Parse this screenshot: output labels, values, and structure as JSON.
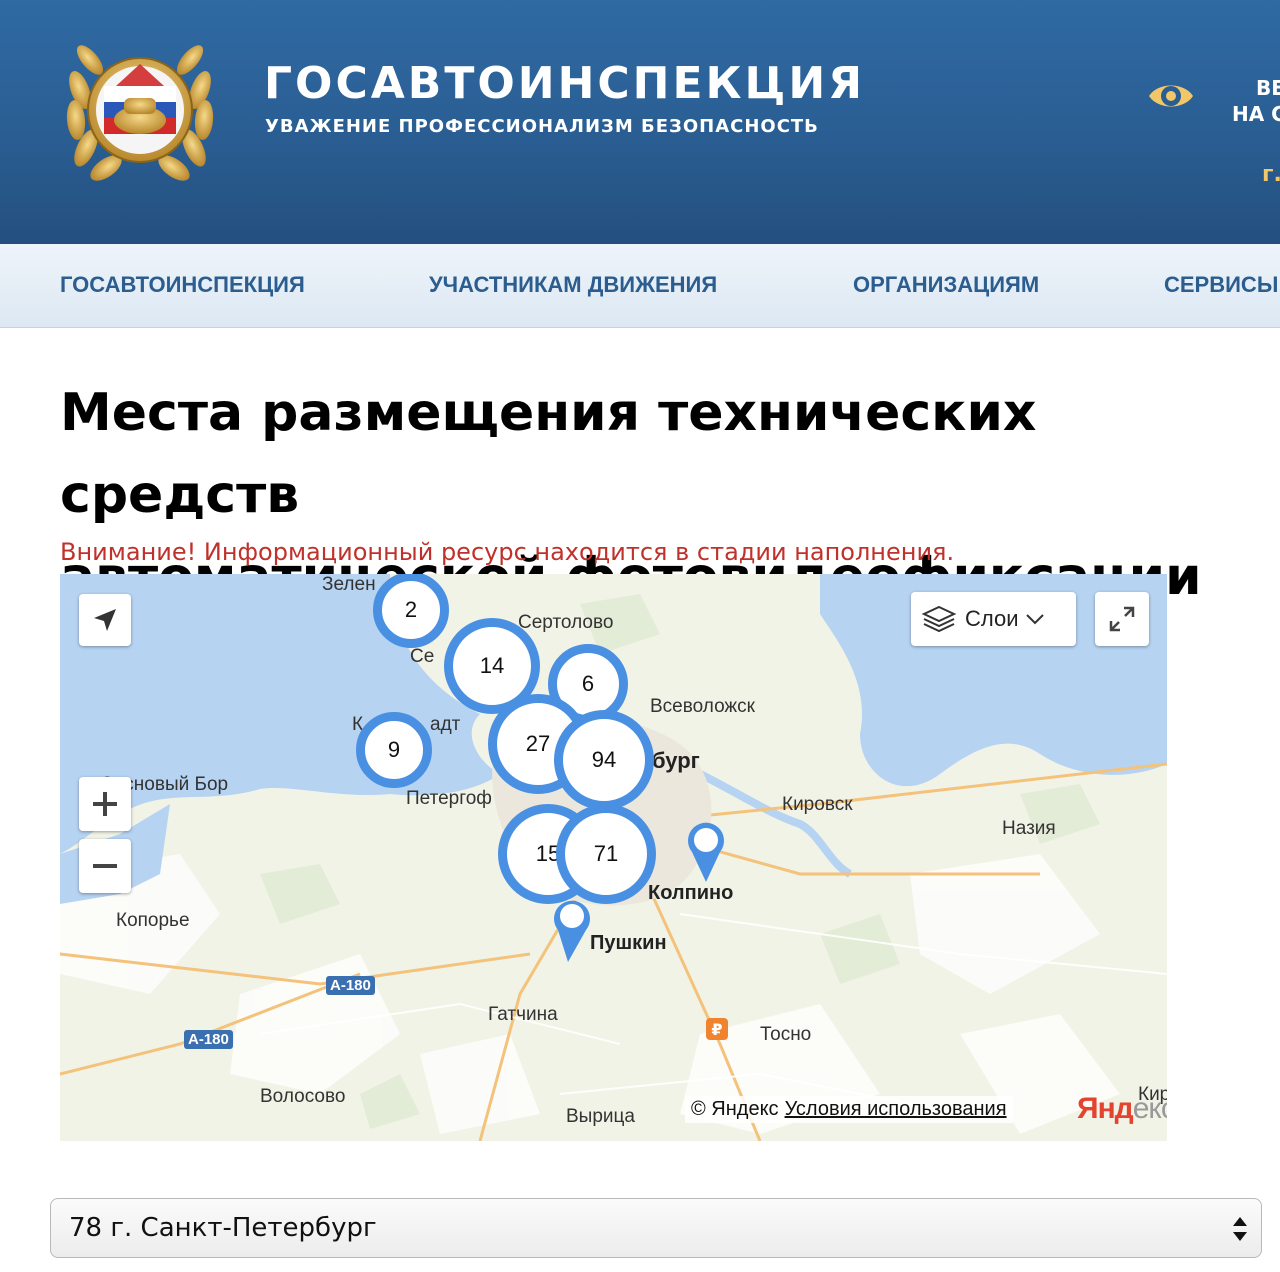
{
  "header": {
    "brand_title": "ГОСАВТОИНСПЕКЦИЯ",
    "brand_subtitle": "УВАЖЕНИЕ ПРОФЕССИОНАЛИЗМ БЕЗОПАСНОСТЬ",
    "visually_impaired_line1": "ВЕ",
    "visually_impaired_line2": "НА С",
    "region_short": "г.",
    "colors": {
      "background": "#2a5e93",
      "accent": "#f1c76a"
    }
  },
  "nav": {
    "items": [
      {
        "label": "ГОСАВТОИНСПЕКЦИЯ"
      },
      {
        "label": "УЧАСТНИКАМ ДВИЖЕНИЯ"
      },
      {
        "label": "ОРГАНИЗАЦИЯМ"
      },
      {
        "label": "СЕРВИСЫ"
      }
    ],
    "text_color": "#2b5d8f"
  },
  "main": {
    "title_line1": "Места размещения технических средств",
    "title_line2": "автоматической фотовидеофиксации",
    "warning": "Внимание! Информационный ресурс находится в стадии наполнения.",
    "warning_color": "#c0312b"
  },
  "map": {
    "layers_label": "Слои",
    "attribution": "© Яндекс",
    "terms_link": "Условия использования",
    "logo_main": "Янд",
    "logo_rest": "екс",
    "places": [
      {
        "name": "Зелен"
      },
      {
        "name": "Сертолово"
      },
      {
        "name": "Се"
      },
      {
        "name": "Всеволожск"
      },
      {
        "name": "К"
      },
      {
        "name": "адт"
      },
      {
        "name": "бург"
      },
      {
        "name": "Сосновый Бор"
      },
      {
        "name": "Петергоф"
      },
      {
        "name": "Кировск"
      },
      {
        "name": "Назия"
      },
      {
        "name": "Колпино"
      },
      {
        "name": "Копорье"
      },
      {
        "name": "Пушкин"
      },
      {
        "name": "Гатчина"
      },
      {
        "name": "Тосно"
      },
      {
        "name": "Волосово"
      },
      {
        "name": "Вырица"
      },
      {
        "name": "Кир"
      }
    ],
    "roads": [
      "А-180",
      "А-180"
    ],
    "clusters": [
      {
        "count": "2"
      },
      {
        "count": "14"
      },
      {
        "count": "6"
      },
      {
        "count": "9"
      },
      {
        "count": "27"
      },
      {
        "count": "94"
      },
      {
        "count": "15"
      },
      {
        "count": "71"
      }
    ],
    "cluster_color": "#4a90e2",
    "ruble_symbol": "₽"
  },
  "region_select": {
    "selected": "78 г. Санкт-Петербург"
  }
}
